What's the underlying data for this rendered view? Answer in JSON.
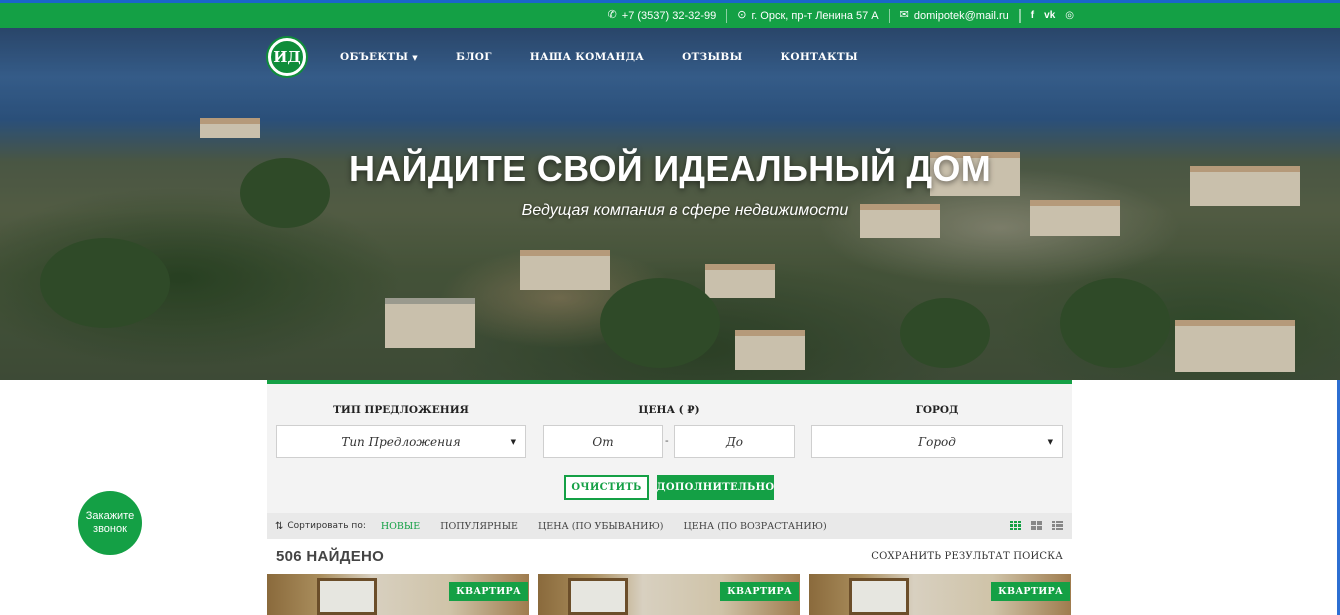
{
  "topbar": {
    "phone": "+7 (3537) 32-32-99",
    "address": "г. Орск, пр-т Ленина 57 А",
    "email": "domipotek@mail.ru",
    "socials": [
      "f",
      "vk",
      "◎"
    ]
  },
  "nav": {
    "logo": "ИД",
    "items": [
      {
        "label": "ОБЪЕКТЫ",
        "has_dropdown": true
      },
      {
        "label": "БЛОГ"
      },
      {
        "label": "НАША КОМАНДА"
      },
      {
        "label": "ОТЗЫВЫ"
      },
      {
        "label": "КОНТАКТЫ"
      }
    ]
  },
  "hero": {
    "title": "НАЙДИТЕ СВОЙ ИДЕАЛЬНЫЙ ДОМ",
    "subtitle": "Ведущая компания в сфере недвижимости"
  },
  "search": {
    "type_label": "ТИП ПРЕДЛОЖЕНИЯ",
    "type_value": "Тип Предложения",
    "price_label": "ЦЕНА ( ₽)",
    "price_from": "От",
    "price_to": "До",
    "city_label": "ГОРОД",
    "city_value": "Город",
    "clear_label": "ОЧИСТИТЬ",
    "more_label": "ДОПОЛНИТЕЛЬНО"
  },
  "sort": {
    "label": "Сортировать по:",
    "options": [
      "НОВЫЕ",
      "ПОПУЛЯРНЫЕ",
      "ЦЕНА (ПО УБЫВАНИЮ)",
      "ЦЕНА (ПО ВОЗРАСТАНИЮ)"
    ],
    "active_index": 0
  },
  "results": {
    "found": "506 НАЙДЕНО",
    "save_search": "СОХРАНИТЬ РЕЗУЛЬТАТ ПОИСКА",
    "cards": [
      {
        "badge": "КВАРТИРА"
      },
      {
        "badge": "КВАРТИРА"
      },
      {
        "badge": "КВАРТИРА"
      }
    ]
  },
  "callback": {
    "label": "Закажите звонок"
  },
  "colors": {
    "accent": "#14a045",
    "topbar_border": "#1a66c9"
  }
}
